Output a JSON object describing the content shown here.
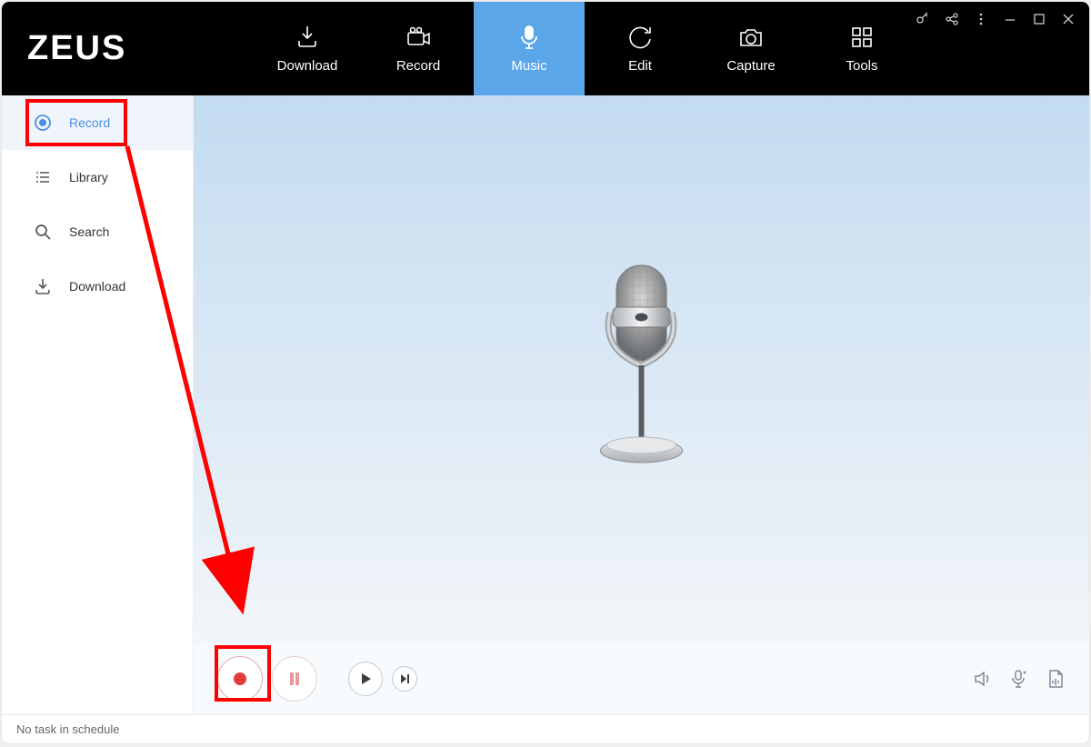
{
  "app": {
    "name": "ZEUS"
  },
  "topnav": {
    "items": [
      {
        "label": "Download"
      },
      {
        "label": "Record"
      },
      {
        "label": "Music"
      },
      {
        "label": "Edit"
      },
      {
        "label": "Capture"
      },
      {
        "label": "Tools"
      }
    ],
    "active_index": 2
  },
  "sidebar": {
    "items": [
      {
        "label": "Record"
      },
      {
        "label": "Library"
      },
      {
        "label": "Search"
      },
      {
        "label": "Download"
      }
    ],
    "active_index": 0
  },
  "statusbar": {
    "text": "No task in schedule"
  },
  "annotations": {
    "highlighted_sidebar_item": "Record",
    "highlighted_control": "record-button"
  }
}
